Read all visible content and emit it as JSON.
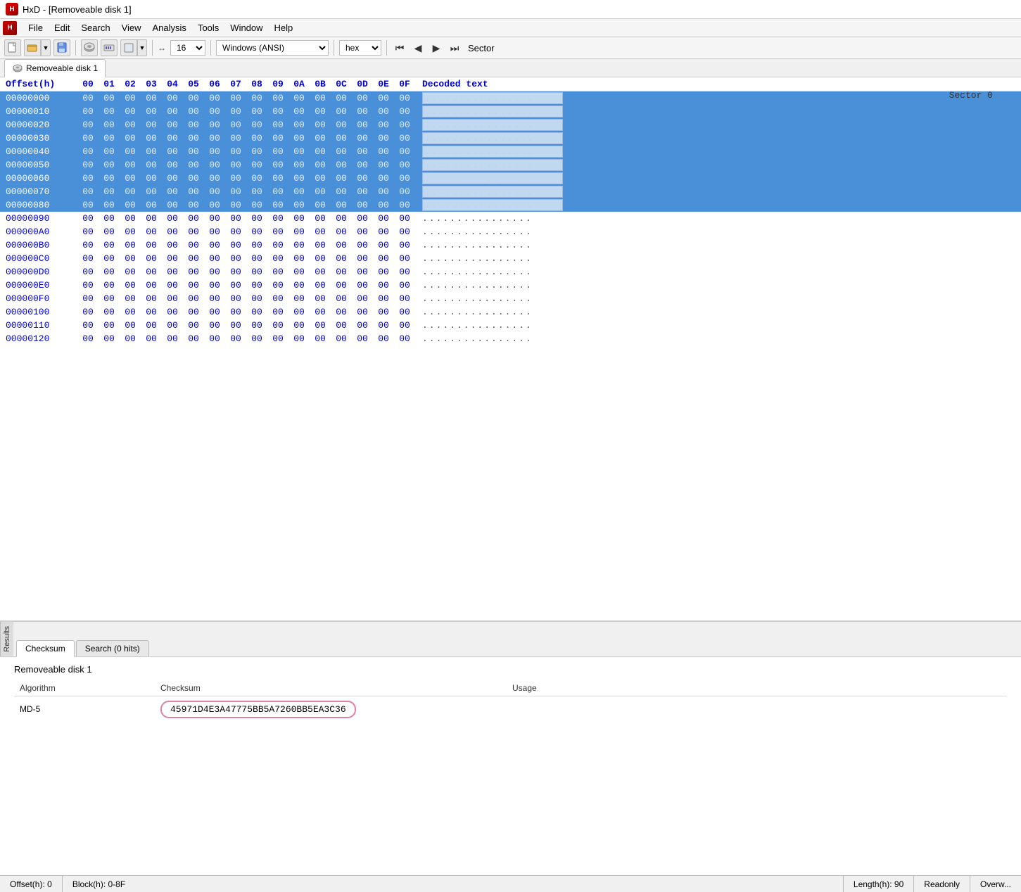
{
  "window": {
    "title": "HxD - [Removeable disk 1]"
  },
  "menu": {
    "icon_label": "HxD",
    "items": [
      "File",
      "Edit",
      "Search",
      "View",
      "Analysis",
      "Tools",
      "Window",
      "Help"
    ]
  },
  "toolbar": {
    "columns_value": "16",
    "encoding_value": "Windows (ANSI)",
    "mode_value": "hex",
    "sector_label": "Sector"
  },
  "tab": {
    "label": "Removeable disk 1"
  },
  "hex_view": {
    "header": {
      "offset": "Offset(h)",
      "cols": [
        "00",
        "01",
        "02",
        "03",
        "04",
        "05",
        "06",
        "07",
        "08",
        "09",
        "0A",
        "0B",
        "0C",
        "0D",
        "0E",
        "0F"
      ],
      "decoded": "Decoded text"
    },
    "rows": [
      {
        "offset": "00000000",
        "selected": true,
        "bytes": "00 00 00 00 00 00 00 00  00 00 00 00 00 00 00 00",
        "decoded": "................"
      },
      {
        "offset": "00000010",
        "selected": true,
        "bytes": "00 00 00 00 00 00 00 00  00 00 00 00 00 00 00 00",
        "decoded": "................"
      },
      {
        "offset": "00000020",
        "selected": true,
        "bytes": "00 00 00 00 00 00 00 00  00 00 00 00 00 00 00 00",
        "decoded": "................"
      },
      {
        "offset": "00000030",
        "selected": true,
        "bytes": "00 00 00 00 00 00 00 00  00 00 00 00 00 00 00 00",
        "decoded": "................"
      },
      {
        "offset": "00000040",
        "selected": true,
        "bytes": "00 00 00 00 00 00 00 00  00 00 00 00 00 00 00 00",
        "decoded": "................"
      },
      {
        "offset": "00000050",
        "selected": true,
        "bytes": "00 00 00 00 00 00 00 00  00 00 00 00 00 00 00 00",
        "decoded": "................"
      },
      {
        "offset": "00000060",
        "selected": true,
        "bytes": "00 00 00 00 00 00 00 00  00 00 00 00 00 00 00 00",
        "decoded": "................"
      },
      {
        "offset": "00000070",
        "selected": true,
        "bytes": "00 00 00 00 00 00 00 00  00 00 00 00 00 00 00 00",
        "decoded": "................"
      },
      {
        "offset": "00000080",
        "selected": true,
        "bytes": "00 00 00 00 00 00 00 00  00 00 00 00 00 00 00 00",
        "decoded": "................"
      },
      {
        "offset": "00000090",
        "selected": false,
        "bytes": "00 00 00 00 00 00 00 00  00 00 00 00 00 00 00 00",
        "decoded": "................"
      },
      {
        "offset": "000000A0",
        "selected": false,
        "bytes": "00 00 00 00 00 00 00 00  00 00 00 00 00 00 00 00",
        "decoded": "................"
      },
      {
        "offset": "000000B0",
        "selected": false,
        "bytes": "00 00 00 00 00 00 00 00  00 00 00 00 00 00 00 00",
        "decoded": "................"
      },
      {
        "offset": "000000C0",
        "selected": false,
        "bytes": "00 00 00 00 00 00 00 00  00 00 00 00 00 00 00 00",
        "decoded": "................"
      },
      {
        "offset": "000000D0",
        "selected": false,
        "bytes": "00 00 00 00 00 00 00 00  00 00 00 00 00 00 00 00",
        "decoded": "................"
      },
      {
        "offset": "000000E0",
        "selected": false,
        "bytes": "00 00 00 00 00 00 00 00  00 00 00 00 00 00 00 00",
        "decoded": "................"
      },
      {
        "offset": "000000F0",
        "selected": false,
        "bytes": "00 00 00 00 00 00 00 00  00 00 00 00 00 00 00 00",
        "decoded": "................"
      },
      {
        "offset": "00000100",
        "selected": false,
        "bytes": "00 00 00 00 00 00 00 00  00 00 00 00 00 00 00 00",
        "decoded": "................"
      },
      {
        "offset": "00000110",
        "selected": false,
        "bytes": "00 00 00 00 00 00 00 00  00 00 00 00 00 00 00 00",
        "decoded": "................"
      },
      {
        "offset": "00000120",
        "selected": false,
        "bytes": "00 00 00 00 00 00 00 00  00 00 00 00 00 00 00 00",
        "decoded": "................"
      }
    ],
    "sector_label": "Sector 0"
  },
  "bottom_panel": {
    "side_label": "Results",
    "tabs": [
      {
        "label": "Checksum",
        "active": true
      },
      {
        "label": "Search (0 hits)",
        "active": false
      }
    ],
    "disk_label": "Removeable disk 1",
    "table": {
      "headers": [
        "Algorithm",
        "Checksum",
        "Usage"
      ],
      "rows": [
        {
          "algorithm": "MD-5",
          "checksum": "45971D4E3A47775BB5A7260BB5EA3C36",
          "usage": ""
        }
      ]
    }
  },
  "status_bar": {
    "offset": "Offset(h): 0",
    "block": "Block(h): 0-8F",
    "length": "Length(h): 90",
    "mode": "Readonly",
    "overwrite": "Overw..."
  }
}
